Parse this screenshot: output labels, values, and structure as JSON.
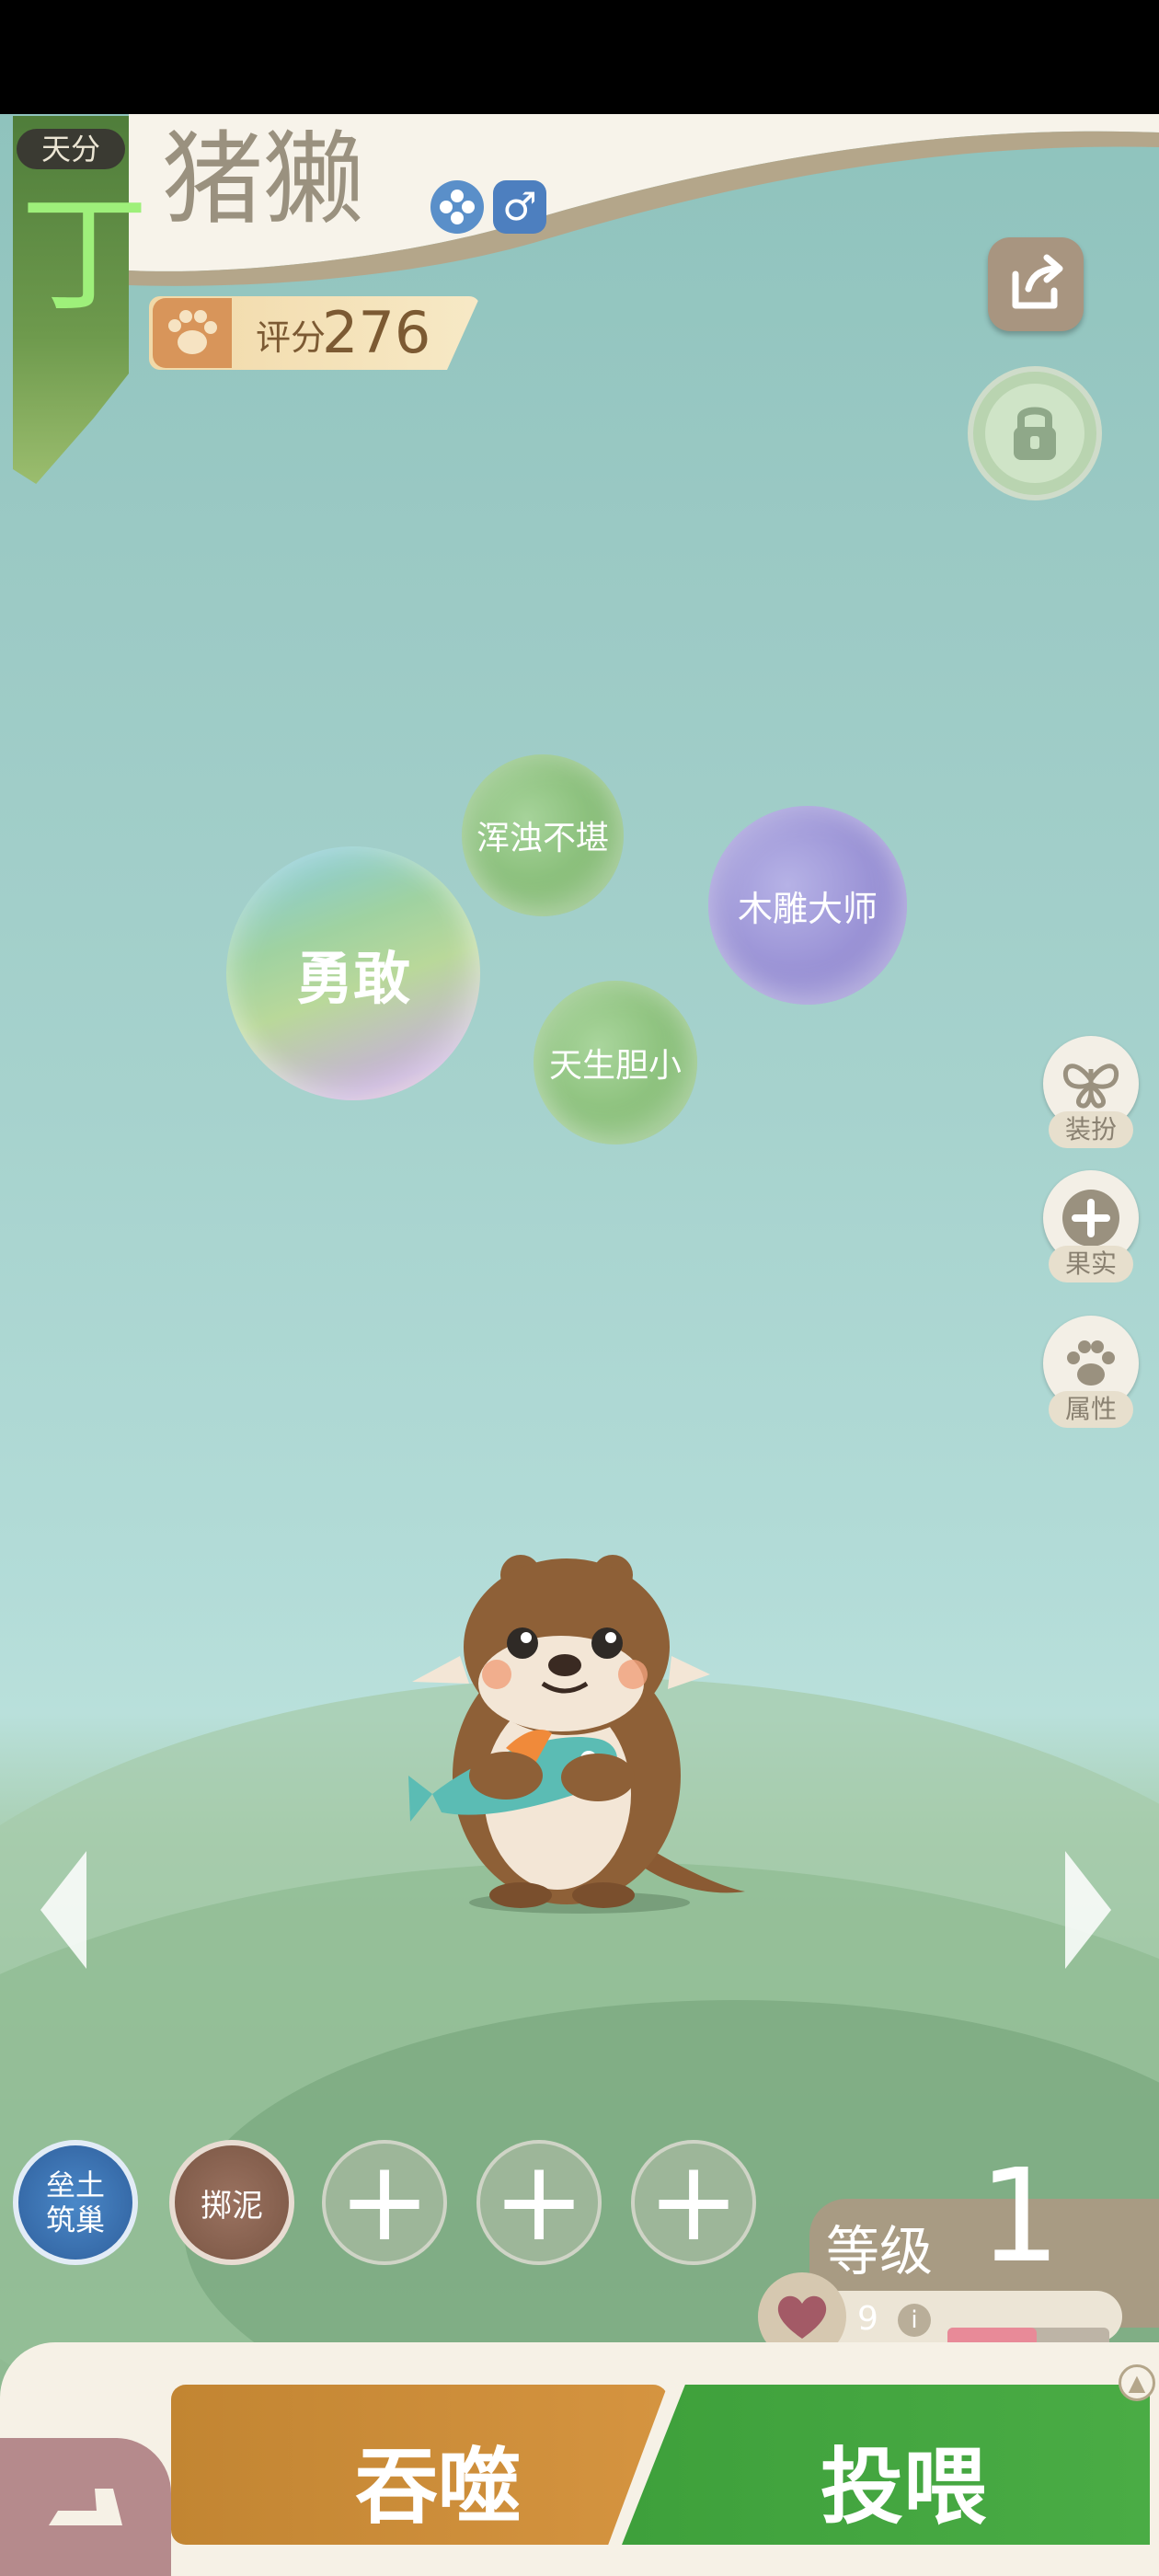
{
  "header": {
    "grade_tag": "天分",
    "grade_letter": "丁",
    "pet_name": "猪獭",
    "score_label": "评分",
    "score_value": "276"
  },
  "icons": {
    "element_icon": "flower-icon",
    "gender_icon": "male-icon",
    "share_icon": "share-icon",
    "lock_icon": "lock-icon"
  },
  "traits": [
    {
      "label": "浑浊不堪"
    },
    {
      "label": "木雕大师"
    },
    {
      "label": "勇敢"
    },
    {
      "label": "天生胆小"
    }
  ],
  "side_menu": [
    {
      "label": "装扮",
      "icon": "butterfly-icon"
    },
    {
      "label": "果实",
      "icon": "plus-icon"
    },
    {
      "label": "属性",
      "icon": "paw-icon"
    }
  ],
  "skills": [
    {
      "label": "垒土筑巢"
    },
    {
      "label": "掷泥"
    }
  ],
  "level": {
    "label": "等级",
    "value": "1",
    "affection": "9",
    "affection_progress": 0.55
  },
  "actions": {
    "devour": "吞噬",
    "feed": "投喂"
  },
  "colors": {
    "devour": "#c98a36",
    "feed": "#45a540",
    "grade_letter": "#9ef07a"
  }
}
